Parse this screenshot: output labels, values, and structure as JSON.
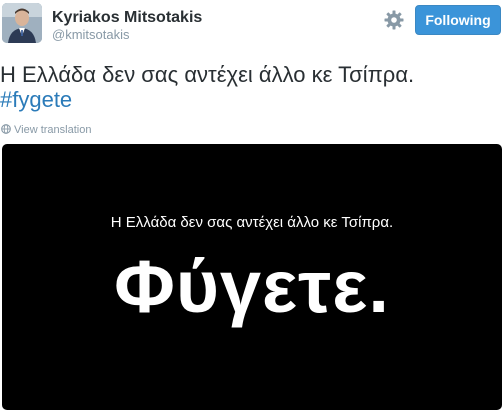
{
  "user": {
    "display_name": "Kyriakos Mitsotakis",
    "screen_name": "@kmitsotakis"
  },
  "actions": {
    "settings_icon": "gear-icon",
    "follow_label": "Following"
  },
  "tweet": {
    "text": "Η Ελλάδα δεν σας αντέχει άλλο κε Τσίπρα.",
    "hashtag": "#fygete",
    "translate_label": "View translation"
  },
  "media": {
    "caption": "Η Ελλάδα δεν σας αντέχει άλλο κε Τσίπρα.",
    "headline": "Φύγετε."
  },
  "colors": {
    "follow_button": "#3b94d9",
    "hashtag": "#2b7bb9",
    "muted_text": "#8899a6",
    "media_background": "#000000"
  }
}
